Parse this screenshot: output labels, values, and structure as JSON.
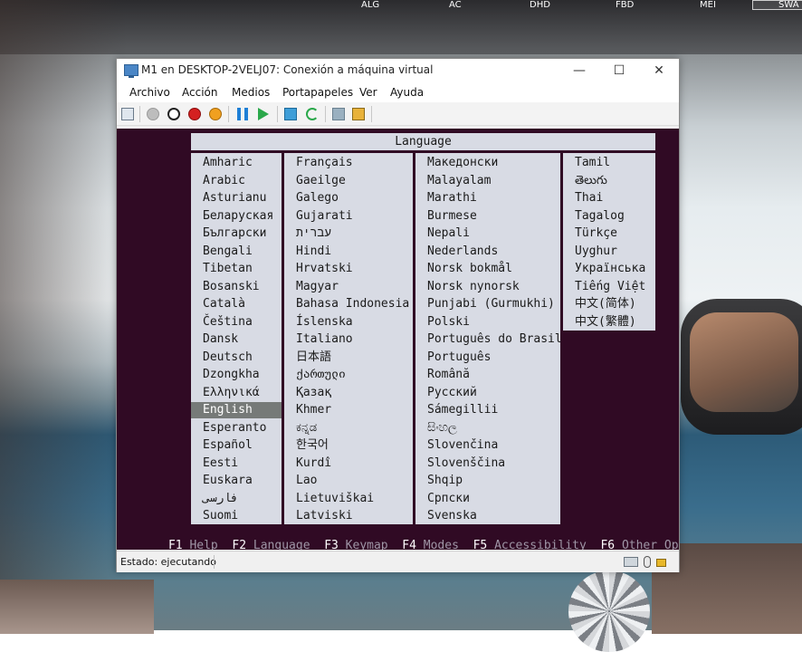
{
  "taskbar": {
    "labels": [
      "ALG",
      "AC",
      "DHD",
      "FBD",
      "MEI",
      "SWA"
    ]
  },
  "window": {
    "title": "M1 en DESKTOP-2VELJ07: Conexión a máquina virtual",
    "minimize": "—",
    "maximize": "☐",
    "close": "✕"
  },
  "menu": [
    "Archivo",
    "Acción",
    "Medios",
    "Portapapeles",
    "Ver",
    "Ayuda"
  ],
  "toolbar_icons": [
    "ctrl-alt-del-icon",
    "start-icon",
    "turn-off-icon",
    "shutdown-icon",
    "save-icon",
    "pause-icon",
    "resume-icon",
    "checkpoint-icon",
    "revert-icon",
    "enhanced-session-icon",
    "share-icon"
  ],
  "installer": {
    "title": "Language",
    "columns": [
      [
        "Amharic",
        "Arabic",
        "Asturianu",
        "Беларуская",
        "Български",
        "Bengali",
        "Tibetan",
        "Bosanski",
        "Català",
        "Čeština",
        "Dansk",
        "Deutsch",
        "Dzongkha",
        "Ελληνικά",
        "English",
        "Esperanto",
        "Español",
        "Eesti",
        "Euskara",
        "فارسی",
        "Suomi"
      ],
      [
        "Français",
        "Gaeilge",
        "Galego",
        "Gujarati",
        "עברית",
        "Hindi",
        "Hrvatski",
        "Magyar",
        "Bahasa Indonesia",
        "Íslenska",
        "Italiano",
        "日本語",
        "ქართული",
        "Қазақ",
        "Khmer",
        "ಕನ್ನಡ",
        "한국어",
        "Kurdî",
        "Lao",
        "Lietuviškai",
        "Latviski"
      ],
      [
        "Македонски",
        "Malayalam",
        "Marathi",
        "Burmese",
        "Nepali",
        "Nederlands",
        "Norsk bokmål",
        "Norsk nynorsk",
        "Punjabi (Gurmukhi)",
        "Polski",
        "Português do Brasil",
        "Português",
        "Română",
        "Русский",
        "Sámegillii",
        "සිංහල",
        "Slovenčina",
        "Slovenščina",
        "Shqip",
        "Српски",
        "Svenska"
      ],
      [
        "Tamil",
        "తెలుగు",
        "Thai",
        "Tagalog",
        "Türkçe",
        "Uyghur",
        "Українська",
        "Tiếng Việt",
        "中文(简体)",
        "中文(繁體)"
      ]
    ],
    "selected": "English",
    "fkeys": [
      {
        "key": "F1",
        "label": "Help"
      },
      {
        "key": "F2",
        "label": "Language"
      },
      {
        "key": "F3",
        "label": "Keymap"
      },
      {
        "key": "F4",
        "label": "Modes"
      },
      {
        "key": "F5",
        "label": "Accessibility"
      },
      {
        "key": "F6",
        "label": "Other Options"
      }
    ]
  },
  "status": {
    "text": "Estado: ejecutando",
    "icons": [
      "keyboard-icon",
      "mouse-icon",
      "lock-icon"
    ]
  }
}
